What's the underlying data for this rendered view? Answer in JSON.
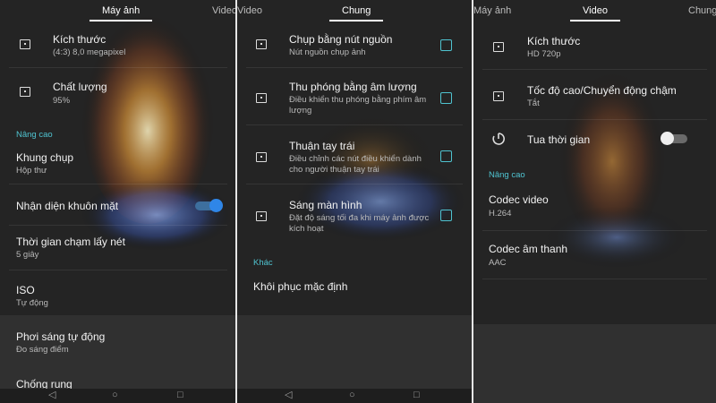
{
  "panel_left": {
    "tabs": {
      "active": "Máy ảnh",
      "right": "Video"
    },
    "items": [
      {
        "title": "Kích thước",
        "sub": "(4:3) 8,0 megapixel"
      },
      {
        "title": "Chất lượng",
        "sub": "95%"
      },
      {
        "title": "Khung chụp",
        "sub": "Hộp thư"
      },
      {
        "title": "Nhận diện khuôn mặt"
      },
      {
        "title": "Thời gian chạm lấy nét",
        "sub": "5 giây"
      },
      {
        "title": "ISO",
        "sub": "Tự động"
      },
      {
        "title": "Phơi sáng tự động",
        "sub": "Đo sáng điểm"
      },
      {
        "title": "Chống rung"
      }
    ],
    "section_advanced": "Nâng cao",
    "face_detect_on": true
  },
  "panel_middle": {
    "tabs": {
      "left": "Video",
      "active": "Chung"
    },
    "items": [
      {
        "title": "Chụp bằng nút nguồn",
        "sub": "Nút nguồn chụp ảnh"
      },
      {
        "title": "Thu phóng bằng âm lượng",
        "sub": "Điều khiển thu phóng bằng phím âm lượng"
      },
      {
        "title": "Thuận tay trái",
        "sub": "Điều chỉnh các nút điều khiển dành cho người thuận tay trái"
      },
      {
        "title": "Sáng màn hình",
        "sub": "Đặt độ sáng tối đa khi máy ảnh được kích hoạt"
      },
      {
        "title": "Khôi phục mặc định"
      }
    ],
    "section_other": "Khác"
  },
  "panel_right": {
    "tabs": {
      "left": "Máy ảnh",
      "active": "Video",
      "right": "Chung"
    },
    "items": [
      {
        "title": "Kích thước",
        "sub": "HD 720p"
      },
      {
        "title": "Tốc độ cao/Chuyển động chậm",
        "sub": "Tắt"
      },
      {
        "title": "Tua thời gian"
      },
      {
        "title": "Codec video",
        "sub": "H.264"
      },
      {
        "title": "Codec âm thanh",
        "sub": "AAC"
      }
    ],
    "section_advanced": "Nâng cao",
    "timelapse_on": false
  },
  "navbar": {
    "back": "◁",
    "home": "○",
    "recent": "□"
  },
  "colors": {
    "accent": "#4fc3d0",
    "toggle_on": "#2f86e8",
    "background": "#242424"
  }
}
